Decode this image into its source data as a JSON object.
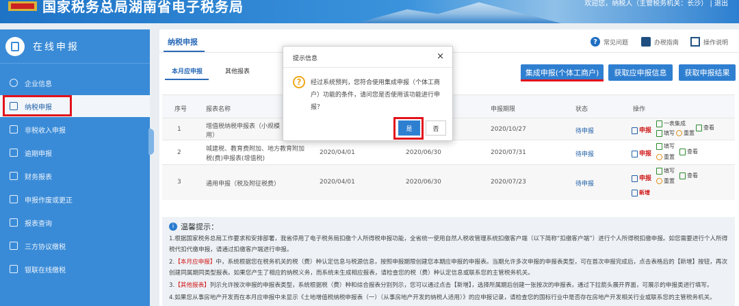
{
  "header": {
    "title": "国家税务总局湖南省电子税务局",
    "right_text": "欢迎您，纳税人（主管税务机关：长沙）  |  退出"
  },
  "sidebar": {
    "title": "在线申报",
    "items": [
      {
        "label": "企业信息"
      },
      {
        "label": "纳税申报"
      },
      {
        "label": "非税收入申报"
      },
      {
        "label": "逾期申报"
      },
      {
        "label": "财务报表"
      },
      {
        "label": "申报作废或更正"
      },
      {
        "label": "报表查询"
      },
      {
        "label": "三方协议缴税"
      },
      {
        "label": "银联在线缴税"
      }
    ]
  },
  "main": {
    "title": "纳税申报",
    "links": {
      "faq": "常见问题",
      "guide": "办税指南",
      "manual": "操作说明"
    },
    "tabs": [
      "本月应申报",
      "其他报表"
    ],
    "buttons": {
      "integrated": "集成申报(个体工商户)",
      "get_due": "获取应申报信息",
      "get_result": "获取申报结果"
    },
    "table": {
      "headers": {
        "no": "序号",
        "name": "报表名称",
        "period": "申报期限",
        "status": "状态",
        "op": "操作"
      },
      "rows": [
        {
          "no": "1",
          "name1": "增值税纳税申报表（小规模",
          "name2": "用）",
          "start": "",
          "end": "",
          "deadline": "2020/10/27",
          "status": "待申报"
        },
        {
          "no": "2",
          "name1": "城建税、教育费附加、地方教育附加",
          "name2": "税(费)申报表(增值税)",
          "start": "2020/04/01",
          "end": "2020/06/30",
          "deadline": "2020/07/31",
          "status": "待申报"
        },
        {
          "no": "3",
          "name1": "通用申报（税及附征税费）",
          "name2": "",
          "start": "2020/04/01",
          "end": "2020/06/30",
          "deadline": "2020/07/23",
          "status": "待申报"
        }
      ],
      "ops": {
        "declare": "申报",
        "batch": "一表集成",
        "fill": "填写",
        "reset": "重置",
        "view": "查看",
        "add": "新增"
      }
    },
    "tips": {
      "title": "温馨提示：",
      "p1": "1.根据国家税务总局工作要求和安排部署，我省停用了电子税务局扣缴个人所得税申报功能，全省统一使用自然人税收管理系统扣缴客户端（以下简称“扣缴客户端”）进行个人所得税扣缴申报。如您需要进行个人所得税代扣代缴申报，请通过扣缴客户端进行申报。",
      "p2_tag": "【本月应申报】",
      "p2": "中，系统根据您在税务机关的税（费）种认定信息与税源信息，按照申报期限创建您本期应申报的申报表。当期允许多次申报的申报表类型，可在首次申报完成后，点击表格后的【新增】按钮，再次创建同属期同类型报表。如果您产生了相应的纳税义务，而系统未生成相应报表，请检查您的税（费）种认定信息或联系您的主管税务机关。",
      "p3_tag": "【其他报表】",
      "p3": "列示允许按次申报的申报表类型，系统根据税（费）种和综合报表分别列示，您可以通过点击【新增】，选择所属期后创建一张按次的申报表，通过下拉箭头展开界面，可展示的申报类进行填写。",
      "p4": "4.如果您从事房地产开发而在本月应申报中未显示《土地增值税纳税申报表（一）（从事房地产开发的纳税人适用）》的应申报记录，请检查您的国标行业中是否存在房地产开发相关行业或联系您的主管税务机关。"
    }
  },
  "dialog": {
    "title": "提示信息",
    "close": "×",
    "message": "经过系统预判，您符合使用集成申报（个体工商户）功能的条件，请问您是否使用该功能进行申报？",
    "yes": "是",
    "no": "否"
  }
}
